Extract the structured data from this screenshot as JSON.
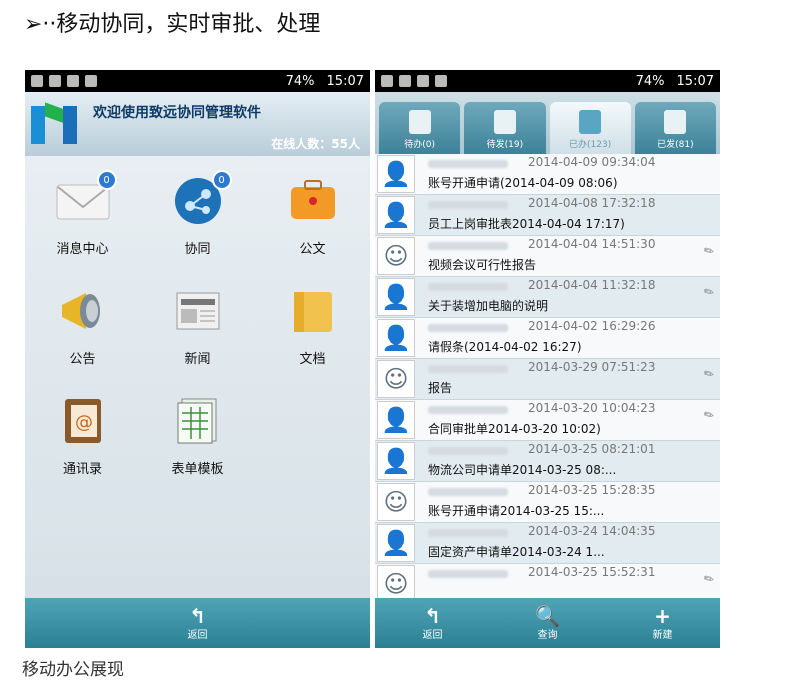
{
  "page": {
    "heading": "➢··移动协同，实时审批、处理",
    "caption": "移动办公展现"
  },
  "status": {
    "battery": "74%",
    "time": "15:07"
  },
  "left": {
    "welcome": "欢迎使用致远协同管理软件",
    "online": "在线人数：55人",
    "items": [
      {
        "label": "消息中心",
        "badge": "0",
        "icon": "envelope-icon"
      },
      {
        "label": "协同",
        "badge": "0",
        "icon": "collaboration-icon"
      },
      {
        "label": "公文",
        "badge": "",
        "icon": "briefcase-icon"
      },
      {
        "label": "公告",
        "badge": "",
        "icon": "megaphone-icon"
      },
      {
        "label": "新闻",
        "badge": "",
        "icon": "newspaper-icon"
      },
      {
        "label": "文档",
        "badge": "",
        "icon": "folder-icon"
      },
      {
        "label": "通讯录",
        "badge": "",
        "icon": "address-book-icon"
      },
      {
        "label": "表单模板",
        "badge": "",
        "icon": "form-template-icon"
      }
    ],
    "bottom": [
      {
        "label": "返回",
        "glyph": "↰"
      }
    ]
  },
  "right": {
    "tabs": [
      {
        "label": "待办(0)"
      },
      {
        "label": "待发(19)"
      },
      {
        "label": "已办(123)"
      },
      {
        "label": "已发(81)"
      }
    ],
    "rows": [
      {
        "ts": "2014-04-09 09:34:04",
        "title": "账号开通申请(2014-04-09 08:06)",
        "attach": false
      },
      {
        "ts": "2014-04-08 17:32:18",
        "title": "员工上岗审批表2014-04-04 17:17)",
        "attach": false
      },
      {
        "ts": "2014-04-04 14:51:30",
        "title": "视频会议可行性报告",
        "attach": true
      },
      {
        "ts": "2014-04-04 11:32:18",
        "title": "关于装增加电脑的说明",
        "attach": true
      },
      {
        "ts": "2014-04-02 16:29:26",
        "title": "请假条(2014-04-02 16:27)",
        "attach": false
      },
      {
        "ts": "2014-03-29 07:51:23",
        "title": "报告",
        "attach": true
      },
      {
        "ts": "2014-03-20 10:04:23",
        "title": "合同审批单2014-03-20 10:02)",
        "attach": true
      },
      {
        "ts": "2014-03-25 08:21:01",
        "title": "物流公司申请单2014-03-25 08:...",
        "attach": false
      },
      {
        "ts": "2014-03-25 15:28:35",
        "title": "账号开通申请2014-03-25 15:...",
        "attach": false
      },
      {
        "ts": "2014-03-24 14:04:35",
        "title": "固定资产申请单2014-03-24 1...",
        "attach": false
      },
      {
        "ts": "2014-03-25 15:52:31",
        "title": "",
        "attach": true
      }
    ],
    "bottom": [
      {
        "label": "返回",
        "glyph": "↰"
      },
      {
        "label": "查询",
        "glyph": "🔍"
      },
      {
        "label": "新建",
        "glyph": "+"
      }
    ]
  }
}
